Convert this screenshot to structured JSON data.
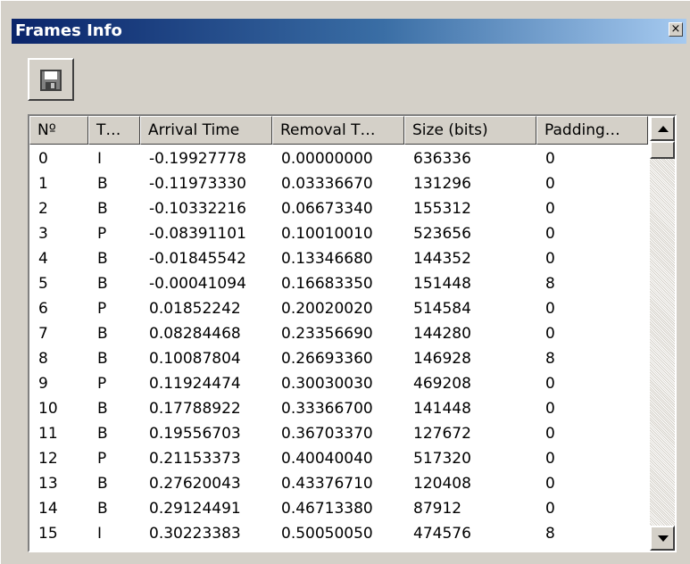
{
  "window": {
    "title": "Frames Info",
    "close_glyph": "×",
    "close_icon": "close-icon"
  },
  "toolbar": {
    "save_icon": "save-disk-icon"
  },
  "table": {
    "columns": [
      "Nº",
      "T…",
      "Arrival Time",
      "Removal T…",
      "Size (bits)",
      "Padding…"
    ],
    "rows": [
      [
        "0",
        "I",
        "-0.19927778",
        "0.00000000",
        "636336",
        "0"
      ],
      [
        "1",
        "B",
        "-0.11973330",
        "0.03336670",
        "131296",
        "0"
      ],
      [
        "2",
        "B",
        "-0.10332216",
        "0.06673340",
        "155312",
        "0"
      ],
      [
        "3",
        "P",
        "-0.08391101",
        "0.10010010",
        "523656",
        "0"
      ],
      [
        "4",
        "B",
        "-0.01845542",
        "0.13346680",
        "144352",
        "0"
      ],
      [
        "5",
        "B",
        "-0.00041094",
        "0.16683350",
        "151448",
        "8"
      ],
      [
        "6",
        "P",
        "0.01852242",
        "0.20020020",
        "514584",
        "0"
      ],
      [
        "7",
        "B",
        "0.08284468",
        "0.23356690",
        "144280",
        "0"
      ],
      [
        "8",
        "B",
        "0.10087804",
        "0.26693360",
        "146928",
        "8"
      ],
      [
        "9",
        "P",
        "0.11924474",
        "0.30030030",
        "469208",
        "0"
      ],
      [
        "10",
        "B",
        "0.17788922",
        "0.33366700",
        "141448",
        "0"
      ],
      [
        "11",
        "B",
        "0.19556703",
        "0.36703370",
        "127672",
        "0"
      ],
      [
        "12",
        "P",
        "0.21153373",
        "0.40040040",
        "517320",
        "0"
      ],
      [
        "13",
        "B",
        "0.27620043",
        "0.43376710",
        "120408",
        "0"
      ],
      [
        "14",
        "B",
        "0.29124491",
        "0.46713380",
        "87912",
        "0"
      ],
      [
        "15",
        "I",
        "0.30223383",
        "0.50050050",
        "474576",
        "8"
      ]
    ]
  },
  "scrollbar": {
    "up_icon": "scroll-up-arrow-icon",
    "down_icon": "scroll-down-arrow-icon"
  },
  "colors": {
    "titlebar_start": "#0a246a",
    "titlebar_end": "#a6caf0",
    "face": "#d4d0c8"
  }
}
